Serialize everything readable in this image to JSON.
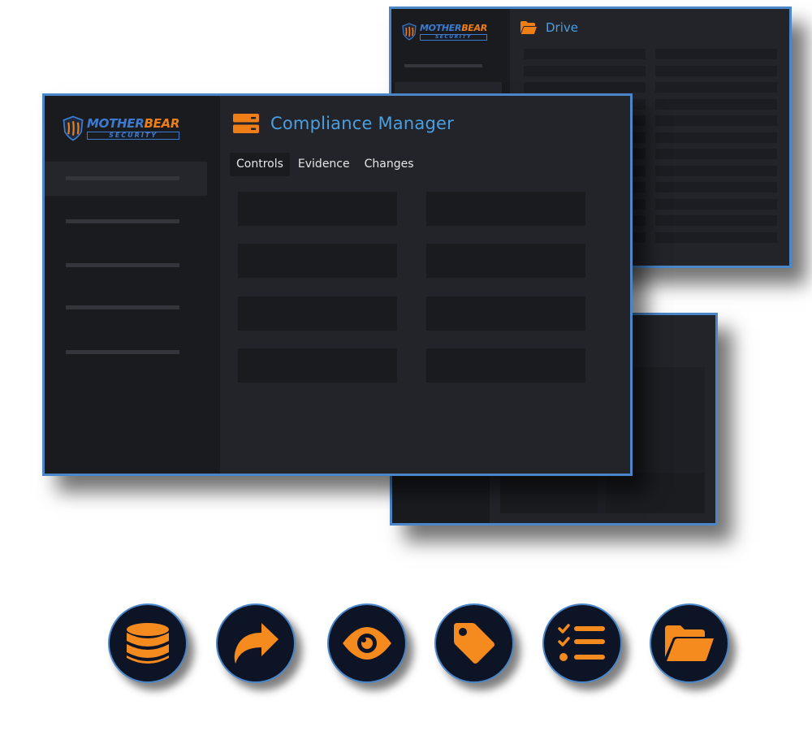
{
  "drive_window": {
    "title": "Drive",
    "logo": {
      "brand_part1": "MOTHER",
      "brand_part2": "BEAR",
      "sub": "SECURITY"
    }
  },
  "main_window": {
    "title": "Compliance Manager",
    "logo": {
      "brand_part1": "MOTHER",
      "brand_part2": "BEAR",
      "sub": "SECURITY"
    },
    "tabs": [
      {
        "label": "Controls",
        "active": true
      },
      {
        "label": "Evidence",
        "active": false
      },
      {
        "label": "Changes",
        "active": false
      }
    ]
  },
  "feature_icons": [
    "database-icon",
    "share-icon",
    "eye-icon",
    "tag-icon",
    "checklist-icon",
    "folder-open-icon"
  ],
  "colors": {
    "accent_blue": "#4a86c8",
    "title_blue": "#4a9fe0",
    "accent_orange": "#f07e16",
    "window_bg": "#23242a",
    "sidebar_bg": "#1a1b1f",
    "circle_bg": "#0c1425"
  }
}
